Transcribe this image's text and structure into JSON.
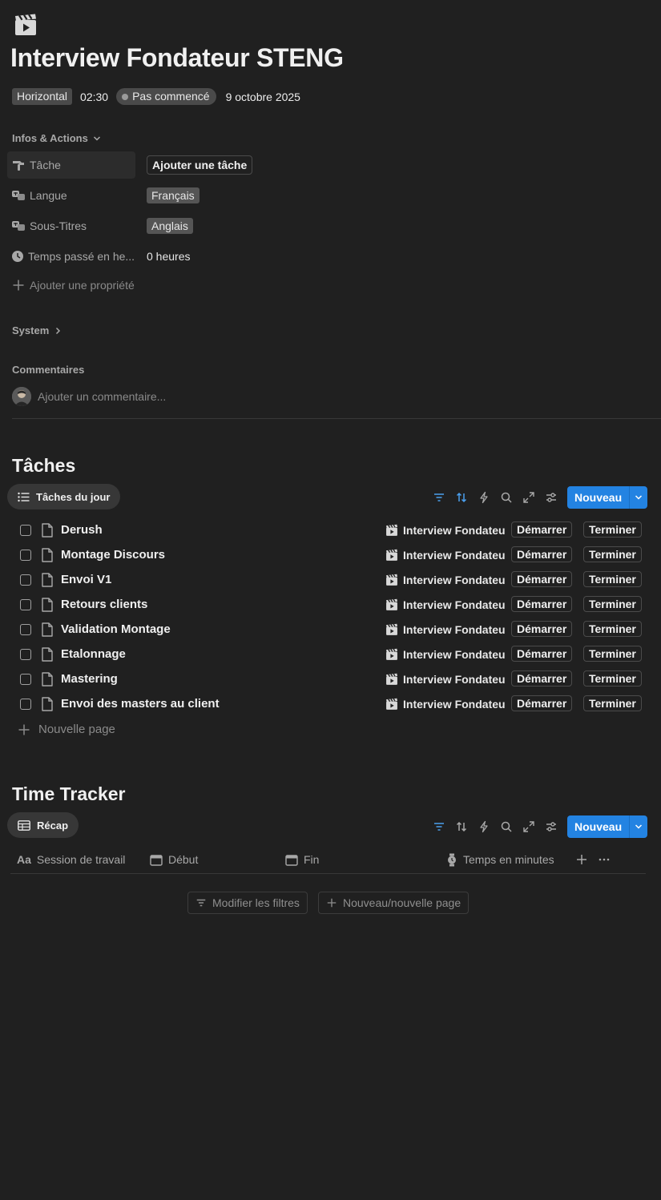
{
  "page": {
    "icon": "clapperboard-icon",
    "title": "Interview Fondateur STENG"
  },
  "meta": {
    "format": "Horizontal",
    "duration": "02:30",
    "status": "Pas commencé",
    "date": "9 octobre 2025"
  },
  "infos": {
    "label": "Infos & Actions",
    "properties": [
      {
        "name": "Tâche",
        "value": "Ajouter une tâche"
      },
      {
        "name": "Langue",
        "value": "Français"
      },
      {
        "name": "Sous-Titres",
        "value": "Anglais"
      },
      {
        "name": "Temps passé en he...",
        "value": "0 heures"
      }
    ],
    "add_property": "Ajouter une propriété"
  },
  "system": {
    "label": "System"
  },
  "comments": {
    "label": "Commentaires",
    "placeholder": "Ajouter un commentaire..."
  },
  "tasks": {
    "heading": "Tâches",
    "view_tab": "Tâches du jour",
    "new_label": "Nouveau",
    "start_label": "Démarrer",
    "finish_label": "Terminer",
    "relation": "Interview Fondateur STENG",
    "rows": [
      {
        "title": "Derush"
      },
      {
        "title": "Montage Discours"
      },
      {
        "title": "Envoi V1"
      },
      {
        "title": "Retours clients"
      },
      {
        "title": "Validation Montage"
      },
      {
        "title": "Etalonnage"
      },
      {
        "title": "Mastering"
      },
      {
        "title": "Envoi des masters au client"
      }
    ],
    "new_page": "Nouvelle page"
  },
  "tracker": {
    "heading": "Time Tracker",
    "view_tab": "Récap",
    "new_label": "Nouveau",
    "columns": {
      "session": "Session de travail",
      "start": "Début",
      "end": "Fin",
      "minutes": "Temps en minutes"
    },
    "edit_filters": "Modifier les filtres",
    "new_page": "Nouveau/nouvelle page"
  },
  "colors": {
    "background": "#202020",
    "accent": "#2383e2"
  }
}
